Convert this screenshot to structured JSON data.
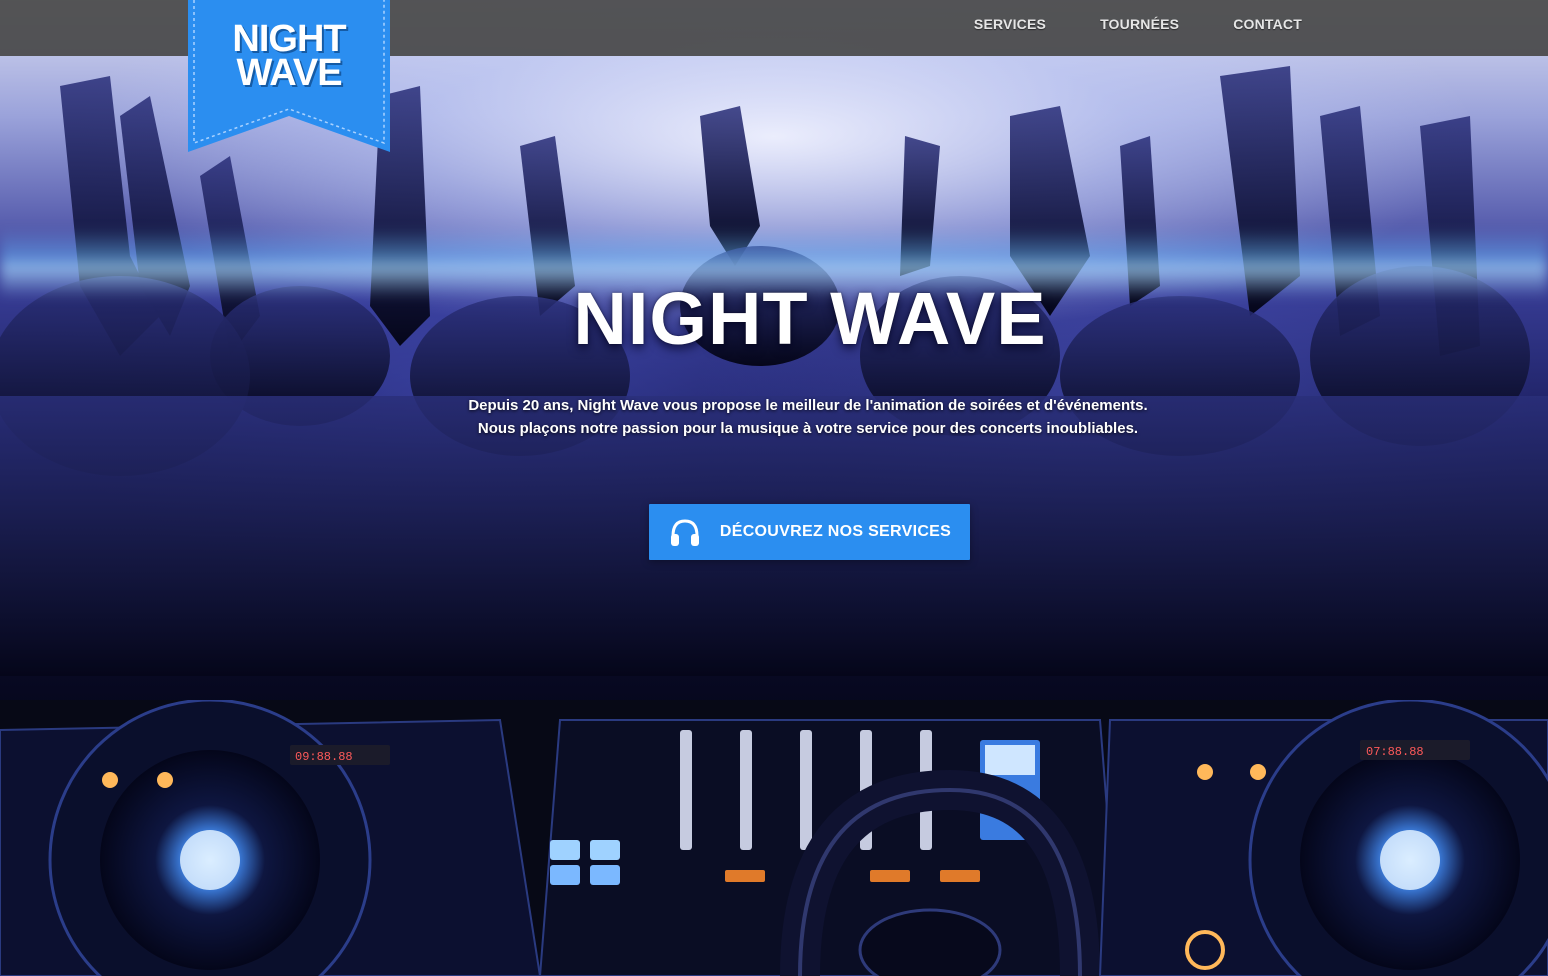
{
  "brand": {
    "logo_line1": "NIGHT",
    "logo_line2": "WAVE",
    "color": "#2b8ef0"
  },
  "nav": {
    "items": [
      {
        "label": "SERVICES"
      },
      {
        "label": "TOURNÉES"
      },
      {
        "label": "CONTACT"
      }
    ]
  },
  "hero": {
    "title": "NIGHT WAVE",
    "tagline_line1": "Depuis 20 ans, Night Wave vous propose le meilleur de l'animation de soirées et d'événements.",
    "tagline_line2": "Nous plaçons notre passion pour la musique à votre service pour des concerts inoubliables.",
    "cta_label": "DÉCOUVREZ NOS SERVICES",
    "cta_icon": "headphones-icon"
  }
}
